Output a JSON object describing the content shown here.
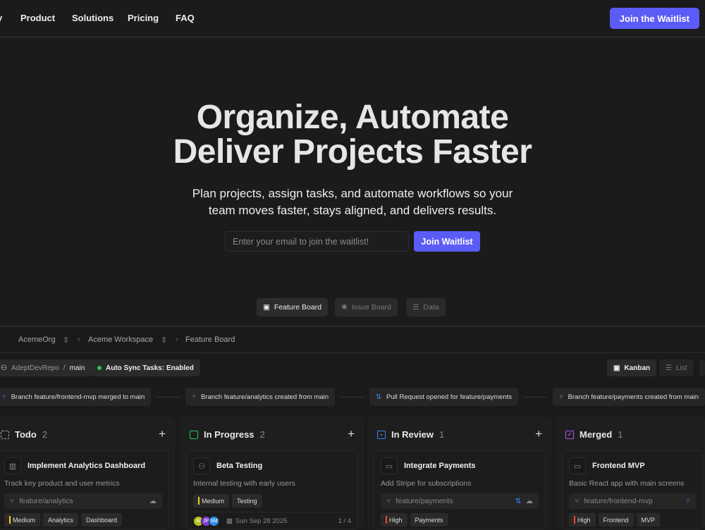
{
  "nav": {
    "items": [
      "Product",
      "Solutions",
      "Pricing",
      "FAQ"
    ],
    "cta": "Join the Waitlist",
    "partial_left": "y"
  },
  "hero": {
    "title_line1": "Organize, Automate",
    "title_line2": "Deliver Projects Faster",
    "subtitle_line1": "Plan projects, assign tasks, and automate workflows so your",
    "subtitle_line2": "team moves faster, stays aligned, and delivers results.",
    "email_placeholder": "Enter your email to join the waitlist!",
    "button": "Join Waitlist"
  },
  "tabs": [
    {
      "label": "Feature Board",
      "active": true
    },
    {
      "label": "Issue Board",
      "active": false
    },
    {
      "label": "Data",
      "active": false
    }
  ],
  "breadcrumb": [
    "AcemeOrg",
    "Aceme Workspace",
    "Feature Board"
  ],
  "repo": {
    "name": "AdeptDevRepo",
    "branch": "main"
  },
  "sync": "Auto Sync Tasks: Enabled",
  "views": [
    "Kanban",
    "List"
  ],
  "events": [
    "Branch feature/frontend-mvp merged to main",
    "Branch feature/analytics created from main",
    "Pull Request opened for feature/payments",
    "Branch feature/payments created from main"
  ],
  "colors": {
    "accent": "#5b5bf6",
    "green": "#22c55e",
    "blue": "#3b82f6",
    "purple": "#a855f7",
    "medium": "#facc15",
    "high": "#ef4444"
  },
  "columns": [
    {
      "title": "Todo",
      "count": "2",
      "card": {
        "title": "Implement Analytics Dashboard",
        "desc": "Track key product and user metrics",
        "branch": "feature/analytics",
        "tags": [
          "Medium",
          "Analytics",
          "Dashboard"
        ]
      }
    },
    {
      "title": "In Progress",
      "count": "2",
      "card": {
        "title": "Beta Testing",
        "desc": "Internal testing with early users",
        "tags": [
          "Medium",
          "Testing"
        ],
        "avatars": [
          "AI",
          "JP",
          "SM"
        ],
        "date": "Sun Sep 28 2025",
        "progress": "1 / 4"
      }
    },
    {
      "title": "In Review",
      "count": "1",
      "card": {
        "title": "Integrate Payments",
        "desc": "Add Stripe for subscriptions",
        "branch": "feature/payments",
        "tags": [
          "High",
          "Payments"
        ]
      }
    },
    {
      "title": "Merged",
      "count": "1",
      "card": {
        "title": "Frontend MVP",
        "desc": "Basic React app with main screens",
        "branch": "feature/frontend-mvp",
        "tags": [
          "High",
          "Frontend",
          "MVP"
        ]
      }
    }
  ]
}
